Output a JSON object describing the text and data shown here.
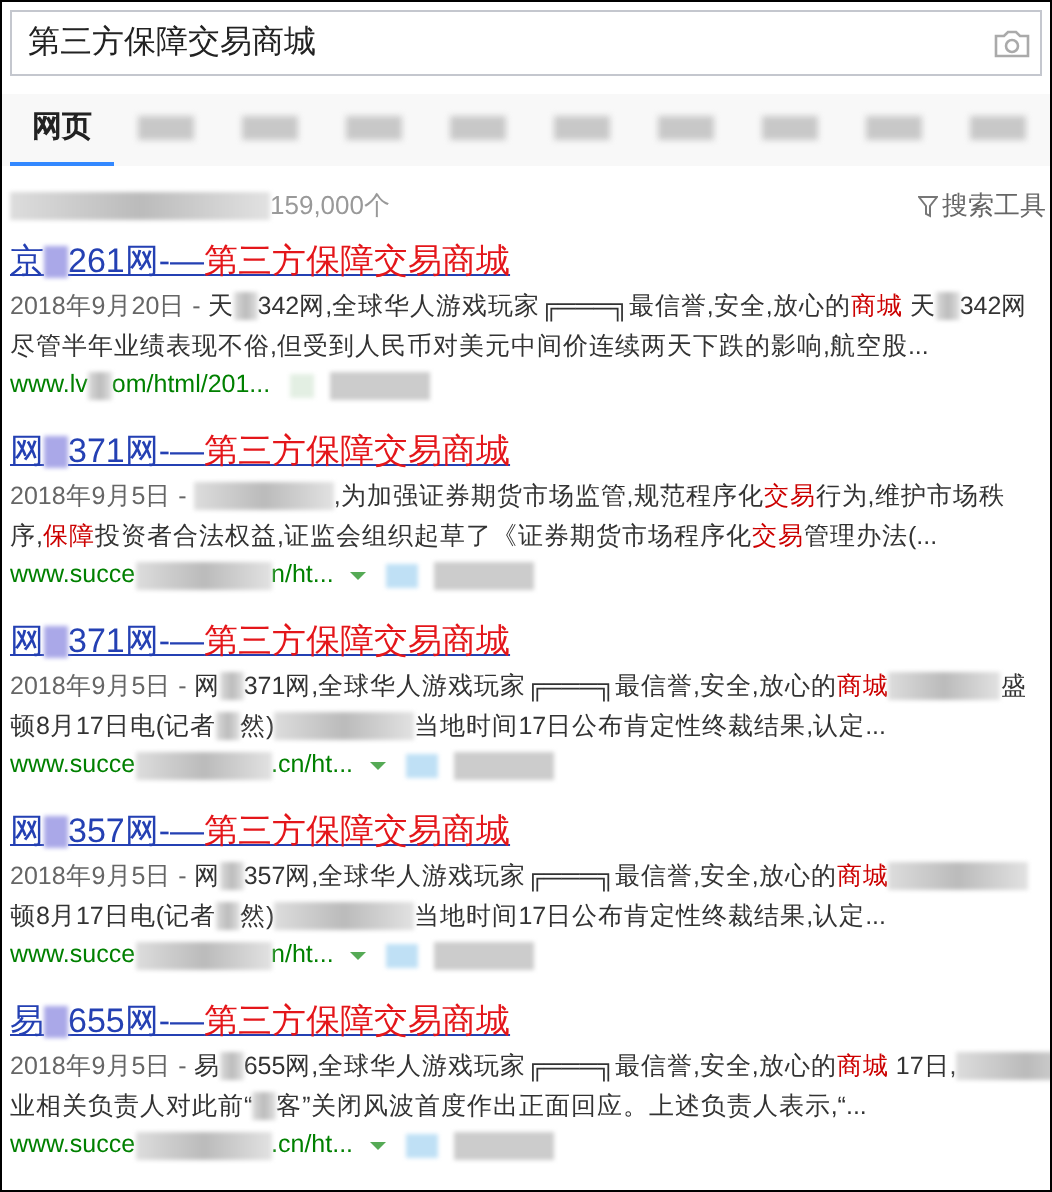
{
  "search": {
    "value": "第三方保障交易商城"
  },
  "tabs": [
    {
      "kind": "text",
      "label": "网页",
      "selected": true
    },
    {
      "kind": "blur",
      "selected": false
    },
    {
      "kind": "blur",
      "selected": false
    },
    {
      "kind": "blur",
      "selected": false
    },
    {
      "kind": "blur",
      "selected": false
    },
    {
      "kind": "blur",
      "selected": false
    },
    {
      "kind": "blur",
      "selected": false
    },
    {
      "kind": "blur",
      "selected": false
    },
    {
      "kind": "blur",
      "selected": false
    },
    {
      "kind": "blur",
      "selected": false
    }
  ],
  "stats": [
    {
      "kind": "blur_long"
    },
    {
      "kind": "text",
      "text": "159,000个"
    }
  ],
  "search_tools": "搜索工具",
  "results": [
    {
      "title": [
        {
          "kind": "text",
          "text": "京"
        },
        {
          "kind": "blur"
        },
        {
          "kind": "text",
          "text": "261网-—"
        },
        {
          "kind": "hl",
          "text": "第三方保障交易商城"
        }
      ],
      "snippet": [
        [
          {
            "kind": "date",
            "text": "2018年9月20日 - "
          },
          {
            "kind": "text",
            "text": "天"
          },
          {
            "kind": "blur"
          },
          {
            "kind": "text",
            "text": "342网,全球华人游戏玩家╔═══╗最信誉,安全,放心的"
          },
          {
            "kind": "hl",
            "text": "商城"
          },
          {
            "kind": "text",
            "text": " 天"
          },
          {
            "kind": "blur"
          },
          {
            "kind": "text",
            "text": "342网"
          }
        ],
        [
          {
            "kind": "text",
            "text": "尽管半年业绩表现不俗,但受到人民币对美元中间价连续两天下跌的影响,航空股..."
          }
        ]
      ],
      "url": [
        {
          "kind": "text",
          "text": "www.lv"
        },
        {
          "kind": "blur"
        },
        {
          "kind": "text",
          "text": "om/html/201..."
        }
      ],
      "arrow": false
    },
    {
      "title": [
        {
          "kind": "text",
          "text": "网"
        },
        {
          "kind": "blur"
        },
        {
          "kind": "text",
          "text": "371网-—"
        },
        {
          "kind": "hl",
          "text": "第三方保障交易商城"
        }
      ],
      "snippet": [
        [
          {
            "kind": "date",
            "text": "2018年9月5日 - "
          },
          {
            "kind": "blur_long"
          },
          {
            "kind": "text",
            "text": ",为加强证券期货市场监管,规范程序化"
          },
          {
            "kind": "hl",
            "text": "交易"
          },
          {
            "kind": "text",
            "text": "行为,维护市场秩"
          }
        ],
        [
          {
            "kind": "text",
            "text": "序,"
          },
          {
            "kind": "hl",
            "text": "保障"
          },
          {
            "kind": "text",
            "text": "投资者合法权益,证监会组织起草了《证券期货市场程序化"
          },
          {
            "kind": "hl",
            "text": "交易"
          },
          {
            "kind": "text",
            "text": "管理办法(..."
          }
        ]
      ],
      "url": [
        {
          "kind": "text",
          "text": "www.succe"
        },
        {
          "kind": "blur_long"
        },
        {
          "kind": "text",
          "text": "n/ht..."
        }
      ],
      "arrow": true
    },
    {
      "title": [
        {
          "kind": "text",
          "text": "网"
        },
        {
          "kind": "blur"
        },
        {
          "kind": "text",
          "text": "371网-—"
        },
        {
          "kind": "hl",
          "text": "第三方保障交易商城"
        }
      ],
      "snippet": [
        [
          {
            "kind": "date",
            "text": "2018年9月5日 - "
          },
          {
            "kind": "text",
            "text": "网"
          },
          {
            "kind": "blur"
          },
          {
            "kind": "text",
            "text": "371网,全球华人游戏玩家╔═══╗最信誉,安全,放心的"
          },
          {
            "kind": "hl",
            "text": "商城"
          },
          {
            "kind": "blur_mid"
          },
          {
            "kind": "text",
            "text": "盛"
          }
        ],
        [
          {
            "kind": "text",
            "text": "顿8月17日电(记者"
          },
          {
            "kind": "blur"
          },
          {
            "kind": "text",
            "text": "然)"
          },
          {
            "kind": "blur_long"
          },
          {
            "kind": "text",
            "text": "当地时间17日公布肯定性终裁结果,认定..."
          }
        ]
      ],
      "url": [
        {
          "kind": "text",
          "text": "www.succe"
        },
        {
          "kind": "blur_long"
        },
        {
          "kind": "text",
          "text": ".cn/ht..."
        }
      ],
      "arrow": true
    },
    {
      "title": [
        {
          "kind": "text",
          "text": "网"
        },
        {
          "kind": "blur"
        },
        {
          "kind": "text",
          "text": "357网-—"
        },
        {
          "kind": "hl",
          "text": "第三方保障交易商城"
        }
      ],
      "snippet": [
        [
          {
            "kind": "date",
            "text": "2018年9月5日 - "
          },
          {
            "kind": "text",
            "text": "网"
          },
          {
            "kind": "blur"
          },
          {
            "kind": "text",
            "text": "357网,全球华人游戏玩家╔═══╗最信誉,安全,放心的"
          },
          {
            "kind": "hl",
            "text": "商城"
          },
          {
            "kind": "blur_long"
          }
        ],
        [
          {
            "kind": "text",
            "text": "顿8月17日电(记者"
          },
          {
            "kind": "blur"
          },
          {
            "kind": "text",
            "text": "然)"
          },
          {
            "kind": "blur_long"
          },
          {
            "kind": "text",
            "text": "当地时间17日公布肯定性终裁结果,认定..."
          }
        ]
      ],
      "url": [
        {
          "kind": "text",
          "text": "www.succe"
        },
        {
          "kind": "blur_long"
        },
        {
          "kind": "text",
          "text": "n/ht..."
        }
      ],
      "arrow": true
    },
    {
      "title": [
        {
          "kind": "text",
          "text": "易"
        },
        {
          "kind": "blur"
        },
        {
          "kind": "text",
          "text": "655网-—"
        },
        {
          "kind": "hl",
          "text": "第三方保障交易商城"
        }
      ],
      "snippet": [
        [
          {
            "kind": "date",
            "text": "2018年9月5日 - "
          },
          {
            "kind": "text",
            "text": "易"
          },
          {
            "kind": "blur"
          },
          {
            "kind": "text",
            "text": "655网,全球华人游戏玩家╔═══╗最信誉,安全,放心的"
          },
          {
            "kind": "hl",
            "text": "商城"
          },
          {
            "kind": "text",
            "text": " 17日,"
          },
          {
            "kind": "blur_long"
          }
        ],
        [
          {
            "kind": "text",
            "text": "业相关负责人对此前“"
          },
          {
            "kind": "blur"
          },
          {
            "kind": "text",
            "text": "客”关闭风波首度作出正面回应。上述负责人表示,“..."
          }
        ]
      ],
      "url": [
        {
          "kind": "text",
          "text": "www.succe"
        },
        {
          "kind": "blur_long"
        },
        {
          "kind": "text",
          "text": ".cn/ht..."
        }
      ],
      "arrow": true
    }
  ]
}
